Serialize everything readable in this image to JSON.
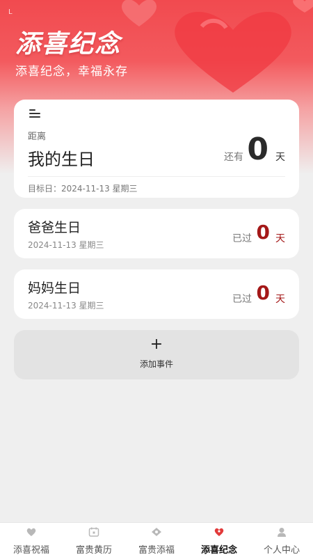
{
  "header": {
    "status_glyph": "L",
    "title": "添喜纪念",
    "subtitle": "添喜纪念，幸福永存"
  },
  "main_event": {
    "menu_icon": "menu-icon",
    "distance_label": "距离",
    "title": "我的生日",
    "remain_label": "还有",
    "days": "0",
    "day_unit": "天",
    "target_date": "目标日：2024-11-13 星期三"
  },
  "events": [
    {
      "title": "爸爸生日",
      "date": "2024-11-13 星期三",
      "passed_label": "已过",
      "days": "0",
      "unit": "天"
    },
    {
      "title": "妈妈生日",
      "date": "2024-11-13 星期三",
      "passed_label": "已过",
      "days": "0",
      "unit": "天"
    }
  ],
  "add_event": {
    "plus": "+",
    "label": "添加事件"
  },
  "tabs": [
    {
      "label": "添喜祝福",
      "icon": "heart-wish-icon"
    },
    {
      "label": "富贵黄历",
      "icon": "calendar-icon"
    },
    {
      "label": "富贵添福",
      "icon": "blessing-icon"
    },
    {
      "label": "添喜纪念",
      "icon": "anniversary-icon",
      "active": true
    },
    {
      "label": "个人中心",
      "icon": "user-icon"
    }
  ],
  "colors": {
    "accent": "#a41818",
    "header_red": "#f14a4f"
  }
}
